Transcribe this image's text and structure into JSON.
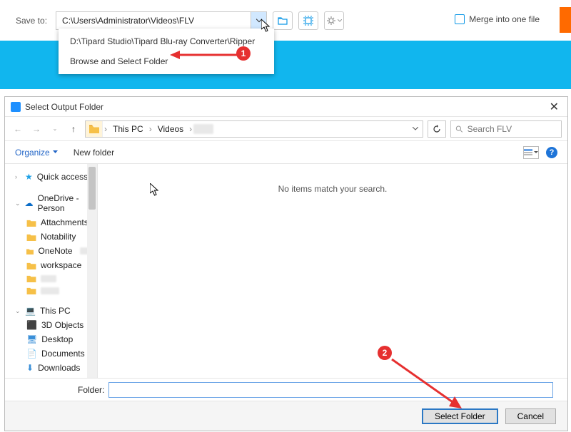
{
  "toolbar": {
    "save_to_label": "Save to:",
    "path_value": "C:\\Users\\Administrator\\Videos\\FLV",
    "merge_label": "Merge into one file"
  },
  "dropdown": {
    "item1": "D:\\Tipard Studio\\Tipard Blu-ray Converter\\Ripper",
    "item2": "Browse and Select Folder"
  },
  "dialog": {
    "title": "Select Output Folder",
    "breadcrumb": {
      "seg1": "This PC",
      "seg2": "Videos"
    },
    "search_placeholder": "Search FLV",
    "organize": "Organize",
    "new_folder": "New folder",
    "empty": "No items match your search.",
    "folder_label": "Folder:",
    "select_btn": "Select Folder",
    "cancel_btn": "Cancel"
  },
  "tree": {
    "quick": "Quick access",
    "onedrive": "OneDrive - Person",
    "attachments": "Attachments",
    "notability": "Notability",
    "onenote": "OneNote",
    "workspace": "workspace",
    "thispc": "This PC",
    "obj3d": "3D Objects",
    "desktop": "Desktop",
    "documents": "Documents",
    "downloads": "Downloads"
  },
  "callouts": {
    "one": "1",
    "two": "2"
  }
}
